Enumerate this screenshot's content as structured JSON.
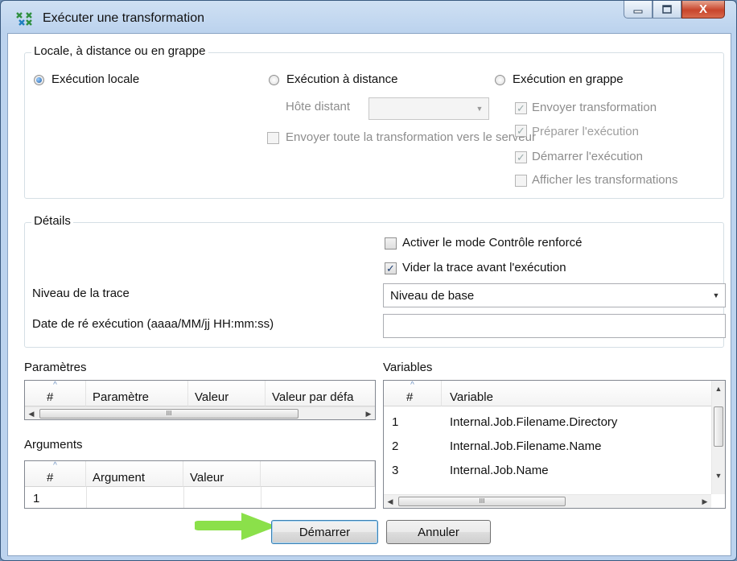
{
  "window": {
    "title": "Exécuter une transformation",
    "buttons": {
      "minimize": "–",
      "maximize": "□",
      "close": "X"
    }
  },
  "mode_group": {
    "legend": "Locale, à distance ou en grappe",
    "options": [
      "Exécution locale",
      "Exécution à distance",
      "Exécution en grappe"
    ],
    "selected": "Exécution locale",
    "remote_host_label": "Hôte distant",
    "remote_host_value": "",
    "send_all_label": "Envoyer toute la transformation vers le serveur",
    "cluster_options": [
      {
        "label": "Envoyer transformation",
        "checked": true
      },
      {
        "label": "Préparer l'exécution",
        "checked": true
      },
      {
        "label": "Démarrer l'exécution",
        "checked": true
      },
      {
        "label": "Afficher les transformations",
        "checked": false
      }
    ]
  },
  "details": {
    "legend": "Détails",
    "safe_mode_label": "Activer le mode Contrôle renforcé",
    "safe_mode_checked": false,
    "clear_log_label": "Vider la trace avant l'exécution",
    "clear_log_checked": true,
    "log_level_label": "Niveau de la trace",
    "log_level_value": "Niveau de base",
    "replay_date_label": "Date de ré exécution (aaaa/MM/jj HH:mm:ss)",
    "replay_date_value": ""
  },
  "parameters": {
    "title": "Paramètres",
    "columns": [
      "#",
      "Paramètre",
      "Valeur",
      "Valeur par défa"
    ]
  },
  "arguments": {
    "title": "Arguments",
    "columns": [
      "#",
      "Argument",
      "Valeur"
    ],
    "rows": [
      [
        "1",
        "",
        ""
      ]
    ]
  },
  "variables": {
    "title": "Variables",
    "columns": [
      "#",
      "Variable"
    ],
    "rows": [
      [
        "1",
        "Internal.Job.Filename.Directory"
      ],
      [
        "2",
        "Internal.Job.Filename.Name"
      ],
      [
        "3",
        "Internal.Job.Name"
      ]
    ]
  },
  "actions": {
    "start": "Démarrer",
    "cancel": "Annuler"
  },
  "scroll_grip": "III",
  "colors": {
    "accent_arrow": "#8be04a",
    "window_frame": "#bcd3ee",
    "selection_blue": "#1e5fa8"
  },
  "icons": [
    "app-transform-icon",
    "minimize-icon",
    "maximize-icon",
    "close-icon",
    "dropdown-arrow-icon",
    "pointer-arrow-icon"
  ]
}
